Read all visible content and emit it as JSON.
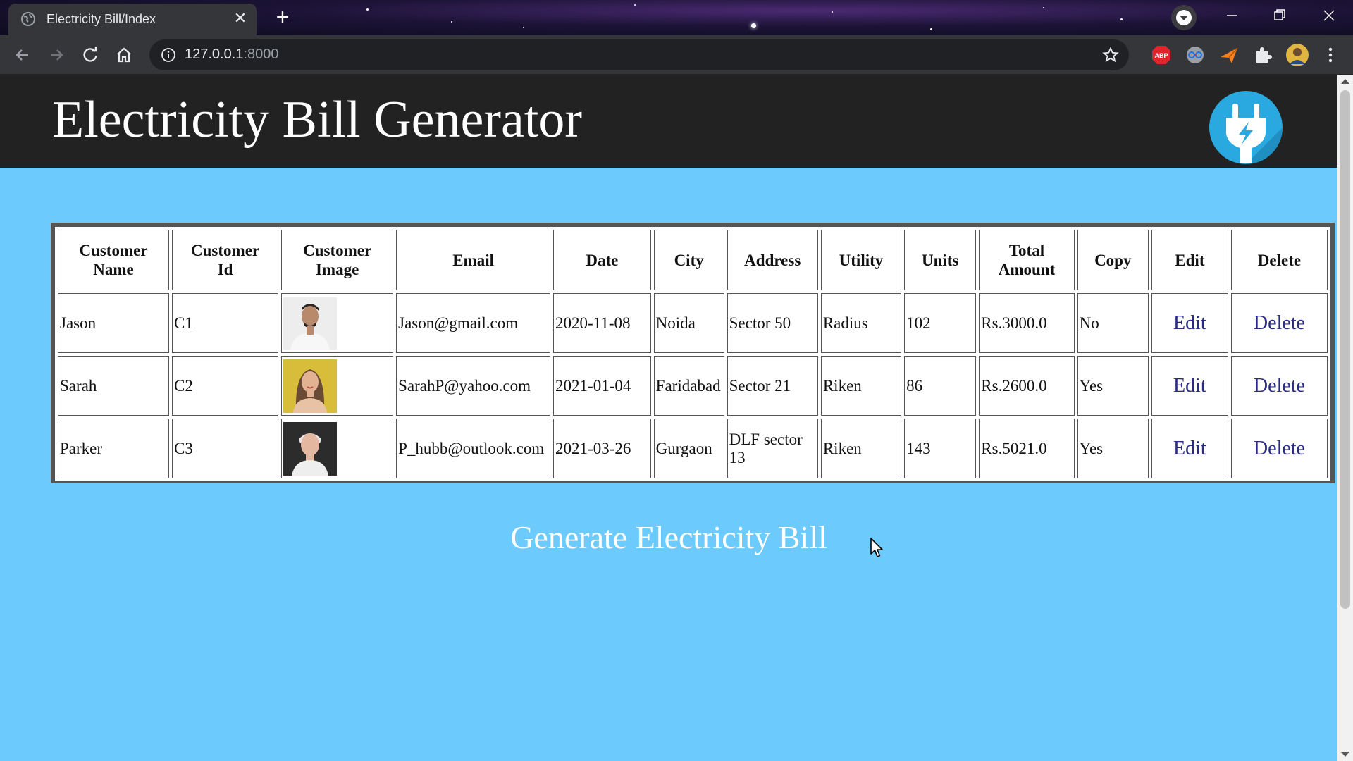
{
  "browser": {
    "tab_title": "Electricity Bill/Index",
    "url_host": "127.0.0.1",
    "url_port": ":8000",
    "new_tab": "+",
    "close_tab": "✕",
    "ext_abp": "ABP"
  },
  "header": {
    "title": "Electricity Bill Generator",
    "accent": "#222222",
    "logo_color": "#29a9df"
  },
  "table": {
    "columns": [
      [
        "Customer",
        "Name"
      ],
      [
        "Customer",
        "Id"
      ],
      [
        "Customer",
        "Image"
      ],
      [
        "Email"
      ],
      [
        "Date"
      ],
      [
        "City"
      ],
      [
        "Address"
      ],
      [
        "Utility"
      ],
      [
        "Units"
      ],
      [
        "Total",
        "Amount"
      ],
      [
        "Copy"
      ],
      [
        "Edit"
      ],
      [
        "Delete"
      ]
    ],
    "rows": [
      {
        "name": "Jason",
        "id": "C1",
        "email": "Jason@gmail.com",
        "date": "2020-11-08",
        "city": "Noida",
        "address": "Sector 50",
        "utility": "Radius",
        "units": "102",
        "amount": "Rs.3000.0",
        "copy": "No",
        "edit": "Edit",
        "delete": "Delete"
      },
      {
        "name": "Sarah",
        "id": "C2",
        "email": "SarahP@yahoo.com",
        "date": "2021-01-04",
        "city": "Faridabad",
        "address": "Sector 21",
        "utility": "Riken",
        "units": "86",
        "amount": "Rs.2600.0",
        "copy": "Yes",
        "edit": "Edit",
        "delete": "Delete"
      },
      {
        "name": "Parker",
        "id": "C3",
        "email": "P_hubb@outlook.com",
        "date": "2021-03-26",
        "city": "Gurgaon",
        "address": "DLF sector 13",
        "utility": "Riken",
        "units": "143",
        "amount": "Rs.5021.0",
        "copy": "Yes",
        "edit": "Edit",
        "delete": "Delete"
      }
    ]
  },
  "generate_label": "Generate Electricity Bill",
  "colors": {
    "page_bg": "#6ccbfc",
    "link": "#2b2d85"
  }
}
